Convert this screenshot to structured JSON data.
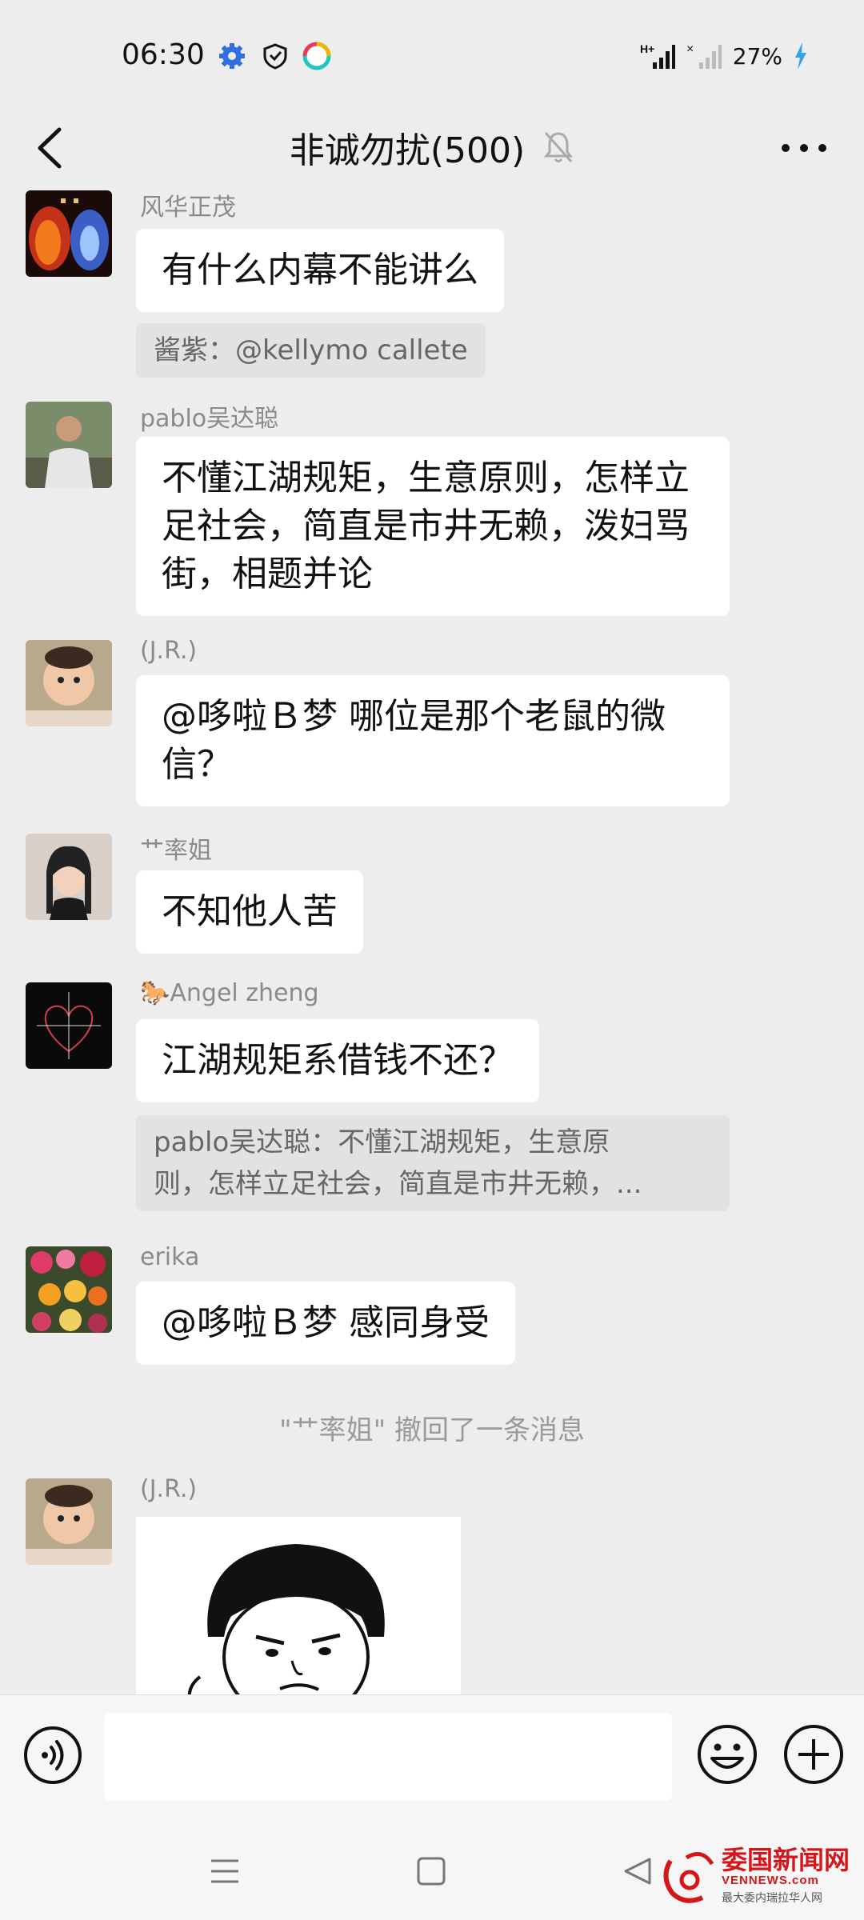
{
  "status_bar": {
    "time": "06:30",
    "battery": "27%",
    "icons": [
      "gear-icon",
      "shield-icon",
      "app-icon",
      "signal-hplus-icon",
      "signal-empty-icon",
      "charging-icon"
    ]
  },
  "header": {
    "title": "非诚勿扰(500)",
    "icons": [
      "back-icon",
      "mute-bell-icon",
      "more-icon"
    ]
  },
  "messages": [
    {
      "sender": "风华正茂",
      "text": "有什么内幕不能讲么",
      "quote": "酱紫：@kellymo callete"
    },
    {
      "sender": "pablo吴达聪",
      "lines": [
        "不懂江湖规矩，生意原则，怎样立",
        "足社会，简直是市井无赖，泼妇骂",
        "街，相题并论"
      ]
    },
    {
      "sender": "(J.R.)",
      "lines": [
        "@哆啦Ｂ梦  哪位是那个老鼠的微",
        "信？"
      ]
    },
    {
      "sender": "艹率姐",
      "text": "不知他人苦"
    },
    {
      "sender": "Angel zheng",
      "sender_emoji": "🐎",
      "text": "江湖规矩系借钱不还？",
      "quote_lines": [
        "pablo吴达聪：不懂江湖规矩，生意原",
        "则，怎样立足社会，简直是市井无赖，..."
      ]
    },
    {
      "sender": "erika",
      "text": "@哆啦Ｂ梦  感同身受"
    },
    {
      "sender": "(J.R.)",
      "type": "sticker"
    }
  ],
  "system_notice": "\"艹率姐\" 撤回了一条消息",
  "input_bar": {
    "icons": [
      "voice-icon",
      "emoji-icon",
      "plus-icon"
    ],
    "value": ""
  },
  "nav_bar": {
    "icons": [
      "menu-icon",
      "home-icon",
      "back-triangle-icon"
    ]
  },
  "watermark": {
    "title": "委国新闻网",
    "site": "VENNEWS.com",
    "slogan": "最大委内瑞拉华人网",
    "color": "#d4161b"
  }
}
